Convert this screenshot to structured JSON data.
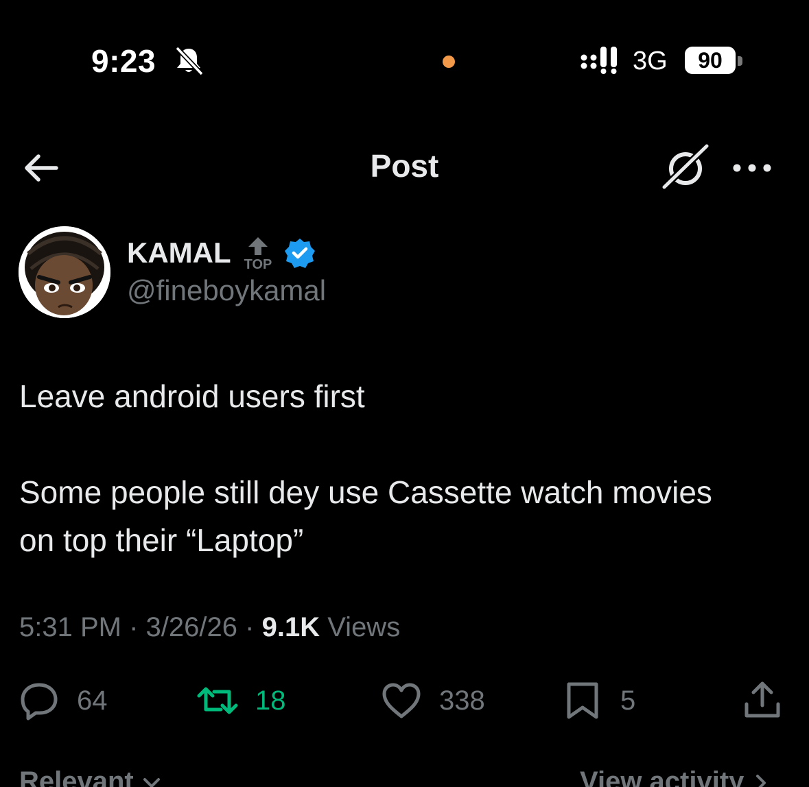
{
  "status_bar": {
    "time": "9:23",
    "network": "3G",
    "battery": "90",
    "accent_dot_color": "#f2994a"
  },
  "header": {
    "title": "Post"
  },
  "author": {
    "name": "KAMAL",
    "badge": "TOP",
    "handle": "@fineboykamal",
    "verified_color": "#1d9bf0"
  },
  "post": {
    "paragraphs": [
      "Leave android users first",
      "Some people still dey use Cassette watch movies",
      "on top their “Laptop”"
    ],
    "time": "5:31 PM",
    "date": "3/26/26",
    "views_count": "9.1K",
    "views_label": "Views",
    "separator": "·"
  },
  "actions": {
    "replies": "64",
    "reposts": "18",
    "likes": "338",
    "bookmarks": "5",
    "repost_color": "#00ba7c"
  },
  "footer": {
    "sort_label": "Relevant",
    "activity_label": "View activity"
  },
  "icons": [
    "bell-slash-icon",
    "signal-icon",
    "back-arrow-icon",
    "grok-icon",
    "more-icon",
    "verified-icon",
    "top-badge-icon",
    "reply-icon",
    "repost-icon",
    "like-icon",
    "bookmark-icon",
    "share-icon",
    "chevron-down-icon",
    "chevron-right-icon"
  ]
}
